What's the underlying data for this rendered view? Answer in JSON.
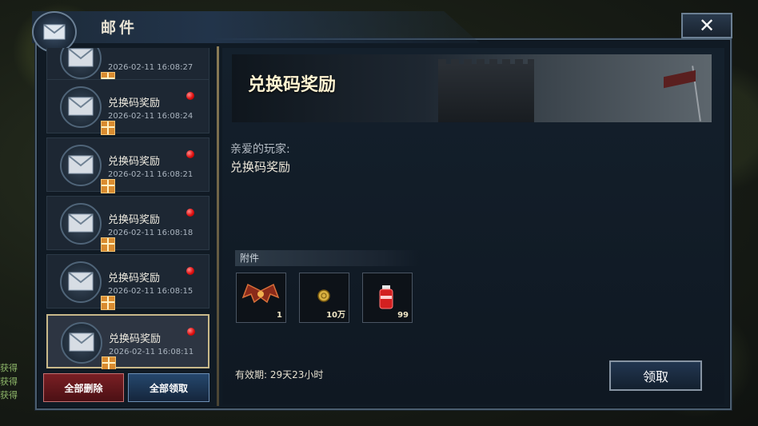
{
  "window": {
    "title": "邮件"
  },
  "side_text": [
    "获得",
    "获得",
    "获得"
  ],
  "mail_list": {
    "items": [
      {
        "title": "",
        "time": "2026-02-11 16:08:27",
        "unread": false
      },
      {
        "title": "兑换码奖励",
        "time": "2026-02-11 16:08:24",
        "unread": true
      },
      {
        "title": "兑换码奖励",
        "time": "2026-02-11 16:08:21",
        "unread": true
      },
      {
        "title": "兑换码奖励",
        "time": "2026-02-11 16:08:18",
        "unread": true
      },
      {
        "title": "兑换码奖励",
        "time": "2026-02-11 16:08:15",
        "unread": true
      },
      {
        "title": "兑换码奖励",
        "time": "2026-02-11 16:08:11",
        "unread": true,
        "selected": true
      }
    ],
    "delete_all_label": "全部删除",
    "claim_all_label": "全部领取"
  },
  "mail_detail": {
    "banner_title": "兑换码奖励",
    "greeting": "亲爱的玩家:",
    "body": "兑换码奖励",
    "attachments_label": "附件",
    "attachments": [
      {
        "icon": "dragon-wings-icon",
        "qty": "1"
      },
      {
        "icon": "gold-coin-icon",
        "qty": "10万"
      },
      {
        "icon": "red-potion-icon",
        "qty": "99"
      }
    ],
    "validity_label": "有效期:",
    "validity_value": "29天23小时",
    "claim_label": "领取"
  },
  "colors": {
    "accent_gold": "#c9b98a",
    "unread_red": "#e01010",
    "panel_bg": "#101a24"
  }
}
